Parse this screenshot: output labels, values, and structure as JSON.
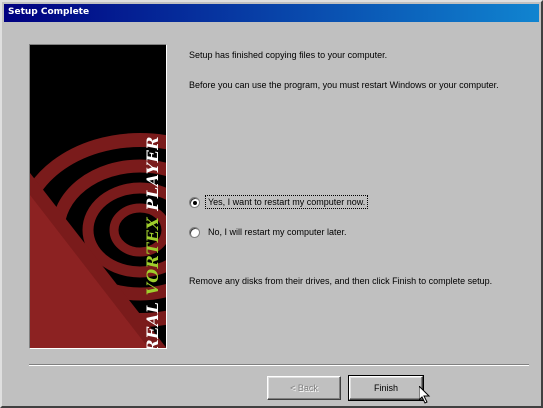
{
  "window": {
    "title": "Setup Complete"
  },
  "banner": {
    "brand_word": "AUREAL",
    "product_word": "VORTEX",
    "player_word": "PLAYER",
    "trademark": "TM",
    "colors": {
      "background": "#000000",
      "swirl": "#7a1b1b",
      "accent": "#9fce2c"
    }
  },
  "content": {
    "message_copied": "Setup has finished copying files to your computer.",
    "message_restart": "Before you can use the program, you must restart Windows or your computer.",
    "message_remove": "Remove any disks from their drives, and then click Finish to complete setup."
  },
  "options": [
    {
      "label": "Yes, I want to restart my computer now.",
      "selected": true
    },
    {
      "label": "No, I will restart my computer later.",
      "selected": false
    }
  ],
  "buttons": {
    "back_label": "< Back",
    "back_enabled": false,
    "finish_label": "Finish"
  },
  "icons": {
    "cursor": "arrow-cursor-icon"
  }
}
